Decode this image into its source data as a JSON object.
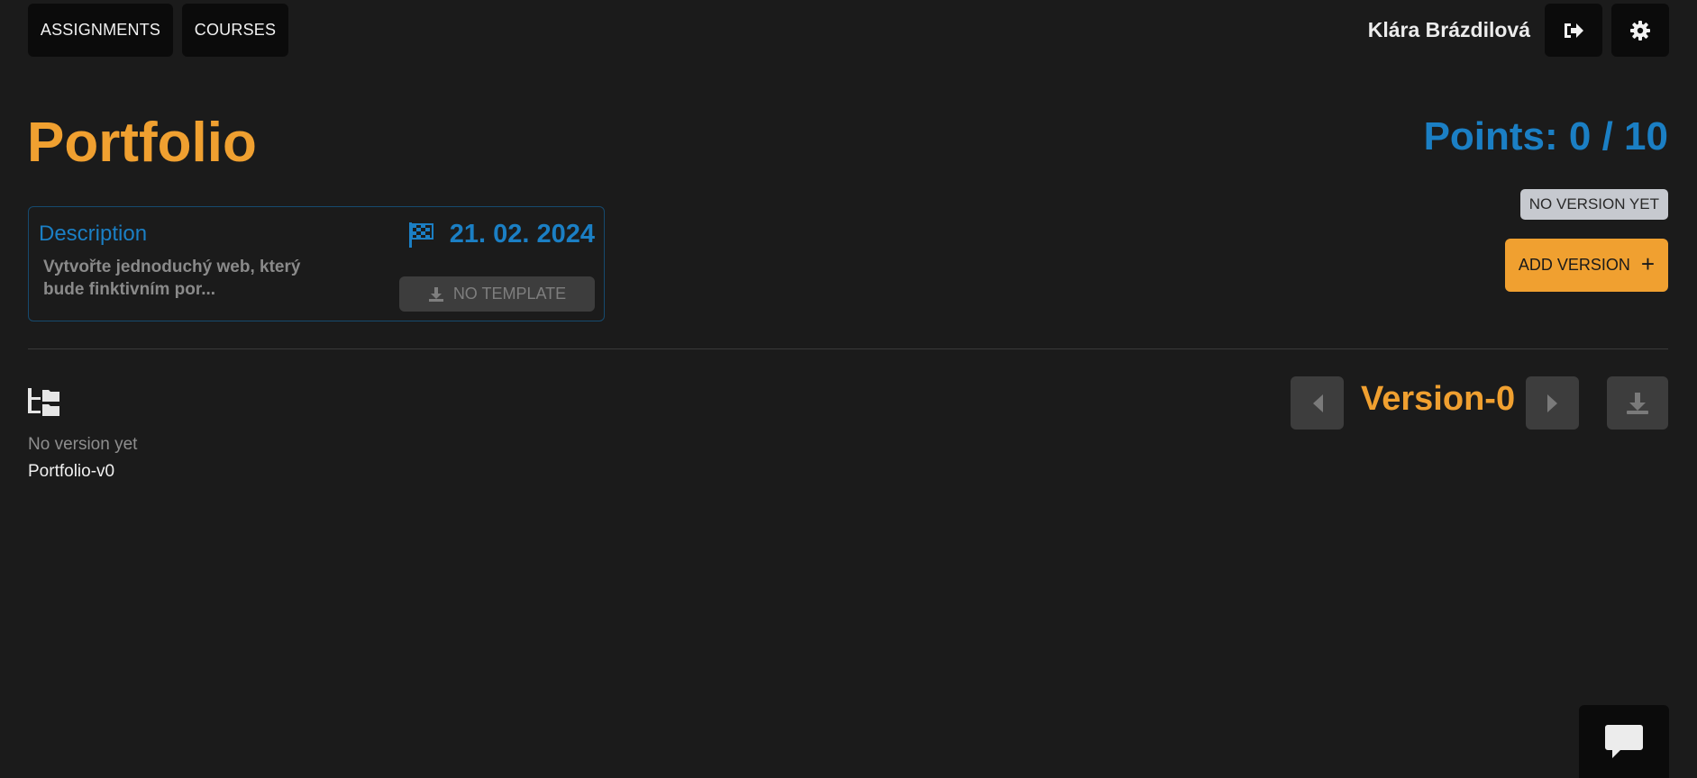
{
  "nav": {
    "assignments_label": "ASSIGNMENTS",
    "courses_label": "COURSES"
  },
  "user": {
    "name": "Klára Brázdilová",
    "logout_icon": "sign-out-icon",
    "settings_icon": "gear-icon"
  },
  "assignment": {
    "title": "Portfolio",
    "points": "Points: 0 / 10"
  },
  "description": {
    "heading": "Description",
    "text": "Vytvořte jednoduchý web, který bude finktivním por...",
    "deadline": "21. 02. 2024",
    "deadline_icon": "checkered-flag-icon",
    "template_label": "NO TEMPLATE",
    "template_icon": "download-icon"
  },
  "version": {
    "status_badge": "NO VERSION YET",
    "add_label": "ADD VERSION",
    "add_icon": "+",
    "current": "Version-0"
  },
  "files": {
    "tree_icon": "folder-tree-icon",
    "empty_text": "No version yet",
    "file_name": "Portfolio-v0"
  },
  "colors": {
    "background": "#1b1b1b",
    "accent_orange": "#f0a030",
    "accent_blue": "#1b7fc4"
  }
}
